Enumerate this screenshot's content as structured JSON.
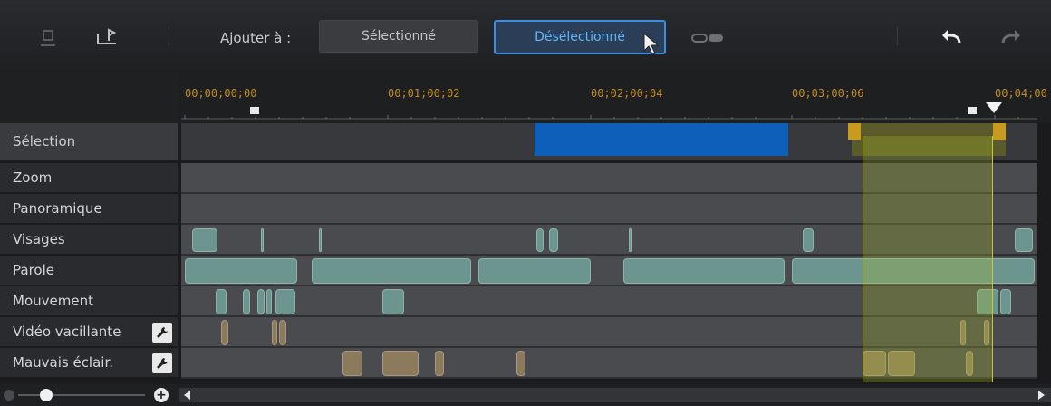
{
  "toolbar": {
    "add_to_label": "Ajouter à :",
    "selected_button": "Sélectionné",
    "deselected_button": "Désélectionné",
    "icons": [
      "mark-in-icon",
      "mark-out-icon",
      "link-icon",
      "undo-icon",
      "redo-icon"
    ]
  },
  "ruler": {
    "timecodes": [
      "00;00;00;00",
      "00;01;00;02",
      "00;02;00;04",
      "00;03;00;06",
      "00;04;00"
    ]
  },
  "rows": {
    "selection": "Sélection",
    "zoom": "Zoom",
    "pan": "Panoramique",
    "faces": "Visages",
    "speech": "Parole",
    "motion": "Mouvement",
    "shaky": "Vidéo vacillante",
    "lighting": "Mauvais éclair."
  },
  "colors": {
    "accent_blue": "#3c8fe0",
    "selection_blue": "#0d5fb8",
    "timecode_orange": "#c28a22",
    "teal_segment": "#6b958e",
    "tan_segment": "#8c7a5c",
    "yellow_range": "#c9c63a"
  }
}
